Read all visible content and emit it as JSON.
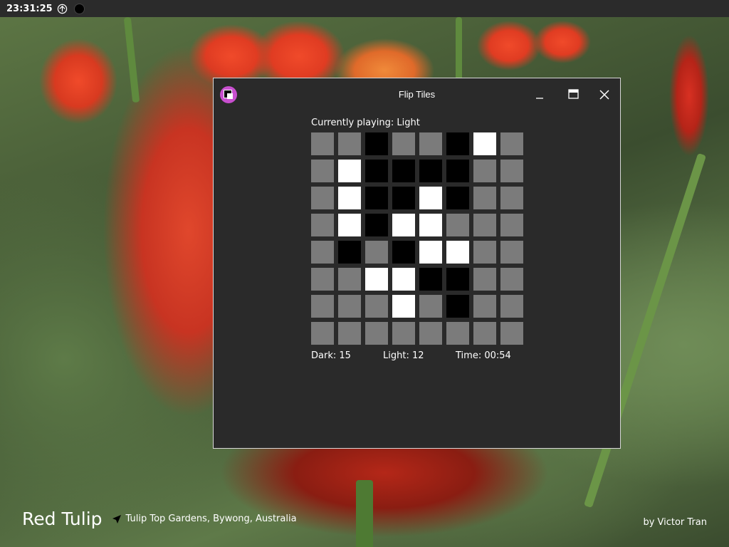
{
  "panel": {
    "clock": "23:31:25",
    "icons": [
      "network-icon",
      "status-dot-icon"
    ]
  },
  "wallpaper": {
    "title": "Red Tulip",
    "location": "Tulip Top Gardens, Bywong, Australia",
    "credit": "by Victor Tran"
  },
  "window": {
    "title": "Flip Tiles",
    "icon": "flip-tiles-app-icon",
    "controls": {
      "minimize": "_",
      "maximize": "maximize-icon",
      "close": "close-icon"
    },
    "status": "Currently playing: Light",
    "board": {
      "size": 8,
      "rows": [
        [
          "empty",
          "empty",
          "dark",
          "empty",
          "empty",
          "dark",
          "light",
          "empty"
        ],
        [
          "empty",
          "light",
          "dark",
          "dark",
          "dark",
          "dark",
          "empty",
          "empty"
        ],
        [
          "empty",
          "light",
          "dark",
          "dark",
          "light",
          "dark",
          "empty",
          "empty"
        ],
        [
          "empty",
          "light",
          "dark",
          "light",
          "light",
          "empty",
          "empty",
          "empty"
        ],
        [
          "empty",
          "dark",
          "empty",
          "dark",
          "light",
          "light",
          "empty",
          "empty"
        ],
        [
          "empty",
          "empty",
          "light",
          "light",
          "dark",
          "dark",
          "empty",
          "empty"
        ],
        [
          "empty",
          "empty",
          "empty",
          "light",
          "empty",
          "dark",
          "empty",
          "empty"
        ],
        [
          "empty",
          "empty",
          "empty",
          "empty",
          "empty",
          "empty",
          "empty",
          "empty"
        ]
      ]
    },
    "scores": {
      "dark": "Dark: 15",
      "light": "Light: 12",
      "time": "Time: 00:54"
    }
  },
  "colors": {
    "window_bg": "#2a2a2a",
    "tile_empty": "#7b7b7b",
    "tile_dark": "#000000",
    "tile_light": "#ffffff",
    "app_icon_accent": "#c84fcf"
  }
}
